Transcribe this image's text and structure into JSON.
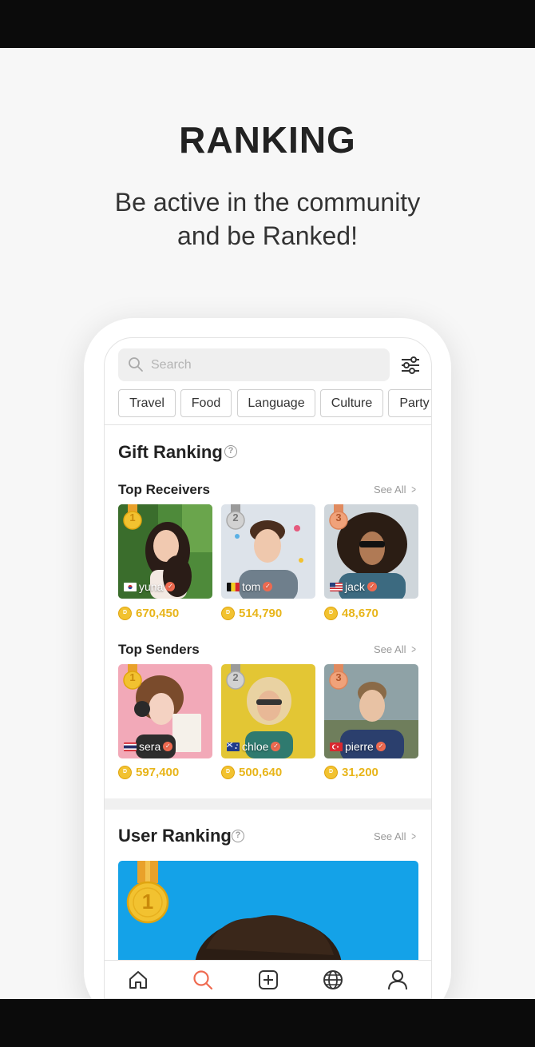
{
  "header": {
    "title": "RANKING",
    "subtitle_line1": "Be active in the community",
    "subtitle_line2": "and be Ranked!"
  },
  "search": {
    "placeholder": "Search"
  },
  "categories": [
    "Travel",
    "Food",
    "Language",
    "Culture",
    "Party"
  ],
  "gift_ranking": {
    "title": "Gift Ranking",
    "help": "?",
    "top_receivers": {
      "title": "Top Receivers",
      "see_all": "See All",
      "items": [
        {
          "rank": "1",
          "name": "yuna",
          "flag": "korea",
          "coins": "670,450"
        },
        {
          "rank": "2",
          "name": "tom",
          "flag": "belgium",
          "coins": "514,790"
        },
        {
          "rank": "3",
          "name": "jack",
          "flag": "usa",
          "coins": "48,670"
        }
      ]
    },
    "top_senders": {
      "title": "Top Senders",
      "see_all": "See All",
      "items": [
        {
          "rank": "1",
          "name": "sera",
          "flag": "thailand",
          "coins": "597,400"
        },
        {
          "rank": "2",
          "name": "chloe",
          "flag": "australia",
          "coins": "500,640"
        },
        {
          "rank": "3",
          "name": "pierre",
          "flag": "turkey",
          "coins": "31,200"
        }
      ]
    }
  },
  "user_ranking": {
    "title": "User Ranking",
    "help": "?",
    "see_all": "See All",
    "top_rank": "1"
  },
  "coin_label": "D",
  "tabs": [
    "home-icon",
    "search-icon",
    "add-post-icon",
    "globe-icon",
    "profile-icon"
  ],
  "colors": {
    "accent": "#ef6a50",
    "coin": "#e8b51a",
    "gold": "#f2c230",
    "silver": "#c9c9c9",
    "bronze": "#f0a27a",
    "user_card_bg": "#14a2e8"
  }
}
